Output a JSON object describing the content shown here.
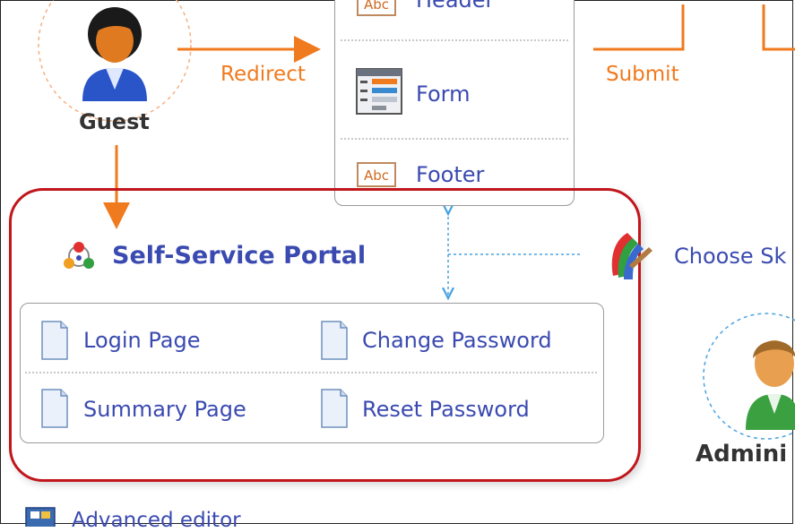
{
  "guest": {
    "label": "Guest"
  },
  "admin": {
    "label": "Admini"
  },
  "links": {
    "redirect": "Redirect",
    "submit": "Submit"
  },
  "layout_items": [
    {
      "label": "Header",
      "icon": "abc-text-icon"
    },
    {
      "label": "Form",
      "icon": "form-icon"
    },
    {
      "label": "Footer",
      "icon": "abc-text-icon"
    }
  ],
  "portal": {
    "title": "Self-Service Portal",
    "icon": "portal-icon",
    "pages": [
      {
        "label": "Login Page",
        "icon": "page-icon"
      },
      {
        "label": "Change Password",
        "icon": "page-icon"
      },
      {
        "label": "Summary Page",
        "icon": "page-icon"
      },
      {
        "label": "Reset Password",
        "icon": "page-icon"
      }
    ]
  },
  "skin": {
    "label": "Choose Sk",
    "icon": "paint-brush-icon"
  },
  "advanced": {
    "label": "Advanced editor",
    "icon": "editor-icon"
  },
  "colors": {
    "flow": "#f07a1e",
    "link_text": "#3a4ab0",
    "portal_border": "#c0161c",
    "connector": "#4aa3e0"
  }
}
